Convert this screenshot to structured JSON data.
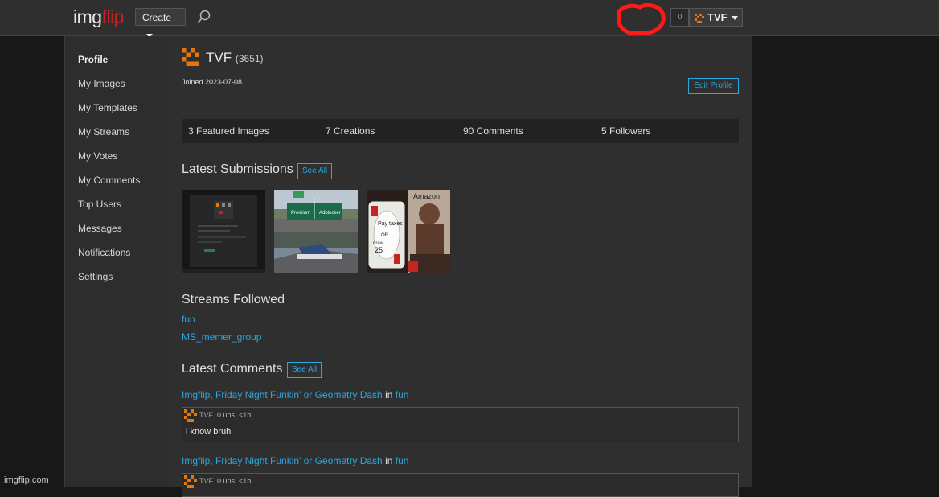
{
  "header": {
    "logo_part1": "img",
    "logo_part2": "flip",
    "create_label": "Create",
    "notification_count": "0",
    "username": "TVF"
  },
  "sidebar": {
    "items": [
      {
        "label": "Profile"
      },
      {
        "label": "My Images"
      },
      {
        "label": "My Templates"
      },
      {
        "label": "My Streams"
      },
      {
        "label": "My Votes"
      },
      {
        "label": "My Comments"
      },
      {
        "label": "Top Users"
      },
      {
        "label": "Messages"
      },
      {
        "label": "Notifications"
      },
      {
        "label": "Settings"
      }
    ]
  },
  "profile": {
    "name": "TVF",
    "points": "(3651)",
    "joined": "Joined 2023-07-08",
    "edit_label": "Edit Profile"
  },
  "stats": {
    "featured": "3 Featured Images",
    "creations": "7 Creations",
    "comments": "90 Comments",
    "followers": "5 Followers"
  },
  "latest_submissions": {
    "title": "Latest Submissions",
    "see_all": "See All",
    "thumb2_sign_left": "Premium",
    "thumb2_sign_right": "Adblocker",
    "thumb3_caption": "Amazon:",
    "thumb3_card_line1": "Pay taxes",
    "thumb3_card_line2": "OR",
    "thumb3_card_line3": "draw",
    "thumb3_card_line4": "25"
  },
  "streams_followed": {
    "title": "Streams Followed",
    "items": [
      "fun",
      "MS_memer_group"
    ]
  },
  "latest_comments": {
    "title": "Latest Comments",
    "see_all": "See All",
    "entries": [
      {
        "source": "Imgflip, Friday Night Funkin' or Geometry Dash",
        "in_word": "in",
        "stream": "fun",
        "user": "TVF",
        "meta": "0 ups, <1h",
        "text": "i know bruh"
      },
      {
        "source": "Imgflip, Friday Night Funkin' or Geometry Dash",
        "in_word": "in",
        "stream": "fun",
        "user": "TVF",
        "meta": "0 ups, <1h",
        "text": ""
      }
    ]
  },
  "footer": {
    "brand": "imgflip.com"
  },
  "colors": {
    "accent": "#29a8e0",
    "logo_red": "#c62323",
    "annotation_red": "#ff1a1a",
    "avatar_orange": "#e8740c"
  },
  "icons": [
    "search-icon",
    "chevron-down-icon",
    "avatar-icon"
  ]
}
